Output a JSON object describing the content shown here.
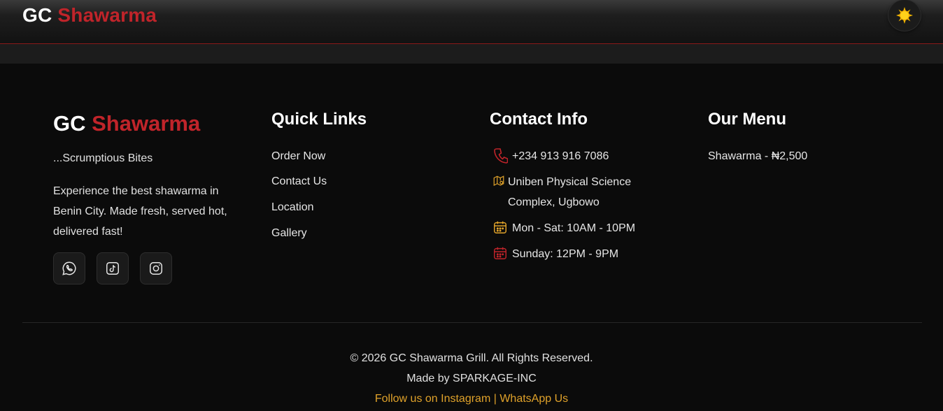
{
  "header": {
    "brand_first": "GC",
    "brand_second": "Shawarma",
    "theme_icon": "sun-icon"
  },
  "footer": {
    "brand_first": "GC",
    "brand_second": "Shawarma",
    "tagline": "...Scrumptious Bites",
    "description": "Experience the best shawarma in Benin City. Made fresh, served hot, delivered fast!",
    "socials": [
      {
        "icon": "whatsapp-icon"
      },
      {
        "icon": "tiktok-icon"
      },
      {
        "icon": "instagram-icon"
      }
    ],
    "quick_links": {
      "title": "Quick Links",
      "items": [
        "Order Now",
        "Contact Us",
        "Location",
        "Gallery"
      ]
    },
    "contact": {
      "title": "Contact Info",
      "phone": "+234 913 916 7086",
      "address": "Uniben Physical Science Complex, Ugbowo",
      "weekday_hours": "Mon - Sat: 10AM - 10PM",
      "sunday_hours": "Sunday: 12PM - 9PM"
    },
    "menu": {
      "title": "Our Menu",
      "items": [
        "Shawarma - ₦2,500"
      ]
    },
    "copyright": "© 2026 GC Shawarma Grill. All Rights Reserved.",
    "made_by": "Made by SPARKAGE-INC",
    "follow_instagram": "Follow us on Instagram",
    "separator": "|",
    "whatsapp_link": "WhatsApp Us"
  },
  "colors": {
    "accent_red": "#c0242a",
    "gold": "#e0a22a",
    "background": "#0b0b0b"
  }
}
